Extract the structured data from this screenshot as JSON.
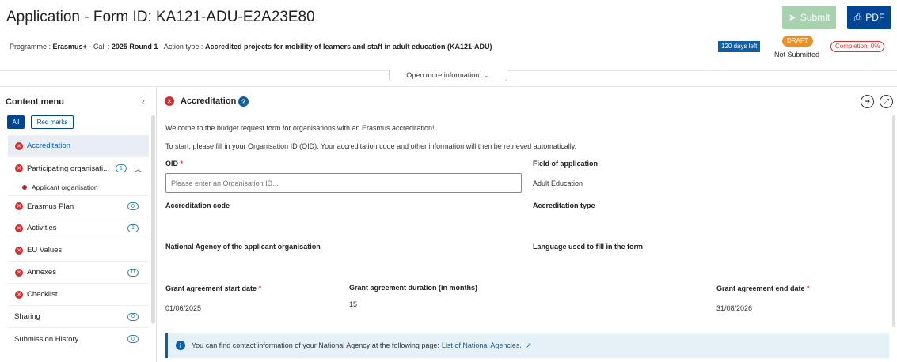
{
  "header": {
    "title": "Application - Form ID: KA121-ADU-E2A23E80",
    "submit_label": "Submit",
    "pdf_label": "PDF",
    "programme_label": "Programme :",
    "programme_value": "Erasmus+",
    "call_label": "- Call :",
    "call_value": "2025 Round 1",
    "action_label": "- Action type :",
    "action_value": "Accredited projects for mobility of learners and staff in adult education (KA121-ADU)",
    "days_left": "120 days left",
    "status_badge": "DRAFT",
    "status_text": "Not Submitted",
    "completion": "Completion: 0%",
    "open_more": "Open more information"
  },
  "sidebar": {
    "title": "Content menu",
    "filter_all": "All",
    "filter_red": "Red marks",
    "items": [
      {
        "label": "Accreditation",
        "count": ""
      },
      {
        "label": "Participating organisati...",
        "count": "1"
      },
      {
        "label": "Applicant organisation",
        "count": ""
      },
      {
        "label": "Erasmus Plan",
        "count": "0"
      },
      {
        "label": "Activities",
        "count": "1"
      },
      {
        "label": "EU Values",
        "count": ""
      },
      {
        "label": "Annexes",
        "count": "0"
      },
      {
        "label": "Checklist",
        "count": ""
      },
      {
        "label": "Sharing",
        "count": "0"
      },
      {
        "label": "Submission History",
        "count": "0"
      }
    ]
  },
  "main": {
    "section_title": "Accreditation",
    "intro1": "Welcome to the budget request form for organisations with an Erasmus accreditation!",
    "intro2": "To start, please fill in your Organisation ID (OID). Your accreditation code and other information will then be retrieved automatically.",
    "oid_label": "OID",
    "oid_placeholder": "Please enter an Organisation ID...",
    "field_label": "Field of application",
    "field_value": "Adult Education",
    "acc_code_label": "Accreditation code",
    "acc_type_label": "Accreditation type",
    "na_label": "National Agency of the applicant organisation",
    "lang_label": "Language used to fill in the form",
    "start_label": "Grant agreement start date",
    "start_value": "01/06/2025",
    "duration_label": "Grant agreement duration (in months)",
    "duration_value": "15",
    "end_label": "Grant agreement end date",
    "end_value": "31/08/2026",
    "info_text": "You can find contact information of your National Agency at the following page:",
    "info_link": "List of National Agencies."
  },
  "colors": {
    "primary": "#004494",
    "error": "#d03030",
    "draft": "#e8902a",
    "submit_disabled": "#a8d1b0"
  }
}
